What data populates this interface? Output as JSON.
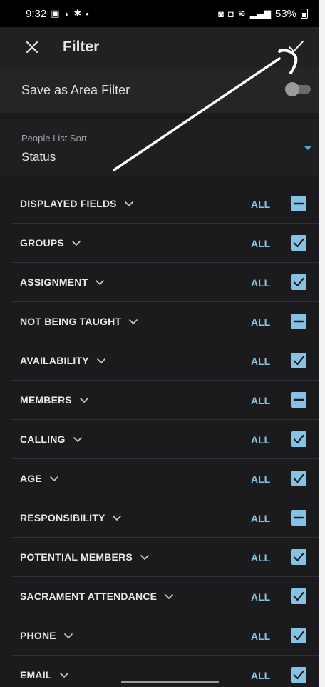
{
  "status_bar": {
    "time": "9:32",
    "battery": "53%"
  },
  "app_bar": {
    "title": "Filter",
    "close_icon": "close-icon",
    "confirm_icon": "check-icon"
  },
  "save_area_filter": {
    "label": "Save as Area Filter",
    "toggle_on": false
  },
  "sort": {
    "label": "People List Sort",
    "value": "Status"
  },
  "colors": {
    "accent": "#85c2e4",
    "background": "#1b1b1d"
  },
  "filters": [
    {
      "name": "DISPLAYED FIELDS",
      "all_label": "ALL",
      "state": "partial"
    },
    {
      "name": "GROUPS",
      "all_label": "ALL",
      "state": "checked"
    },
    {
      "name": "ASSIGNMENT",
      "all_label": "ALL",
      "state": "checked"
    },
    {
      "name": "NOT BEING TAUGHT",
      "all_label": "ALL",
      "state": "partial"
    },
    {
      "name": "AVAILABILITY",
      "all_label": "ALL",
      "state": "checked"
    },
    {
      "name": "MEMBERS",
      "all_label": "ALL",
      "state": "partial"
    },
    {
      "name": "CALLING",
      "all_label": "ALL",
      "state": "checked"
    },
    {
      "name": "AGE",
      "all_label": "ALL",
      "state": "checked"
    },
    {
      "name": "RESPONSIBILITY",
      "all_label": "ALL",
      "state": "partial"
    },
    {
      "name": "POTENTIAL MEMBERS",
      "all_label": "ALL",
      "state": "checked"
    },
    {
      "name": "SACRAMENT ATTENDANCE",
      "all_label": "ALL",
      "state": "checked"
    },
    {
      "name": "PHONE",
      "all_label": "ALL",
      "state": "checked"
    },
    {
      "name": "EMAIL",
      "all_label": "ALL",
      "state": "checked"
    }
  ]
}
